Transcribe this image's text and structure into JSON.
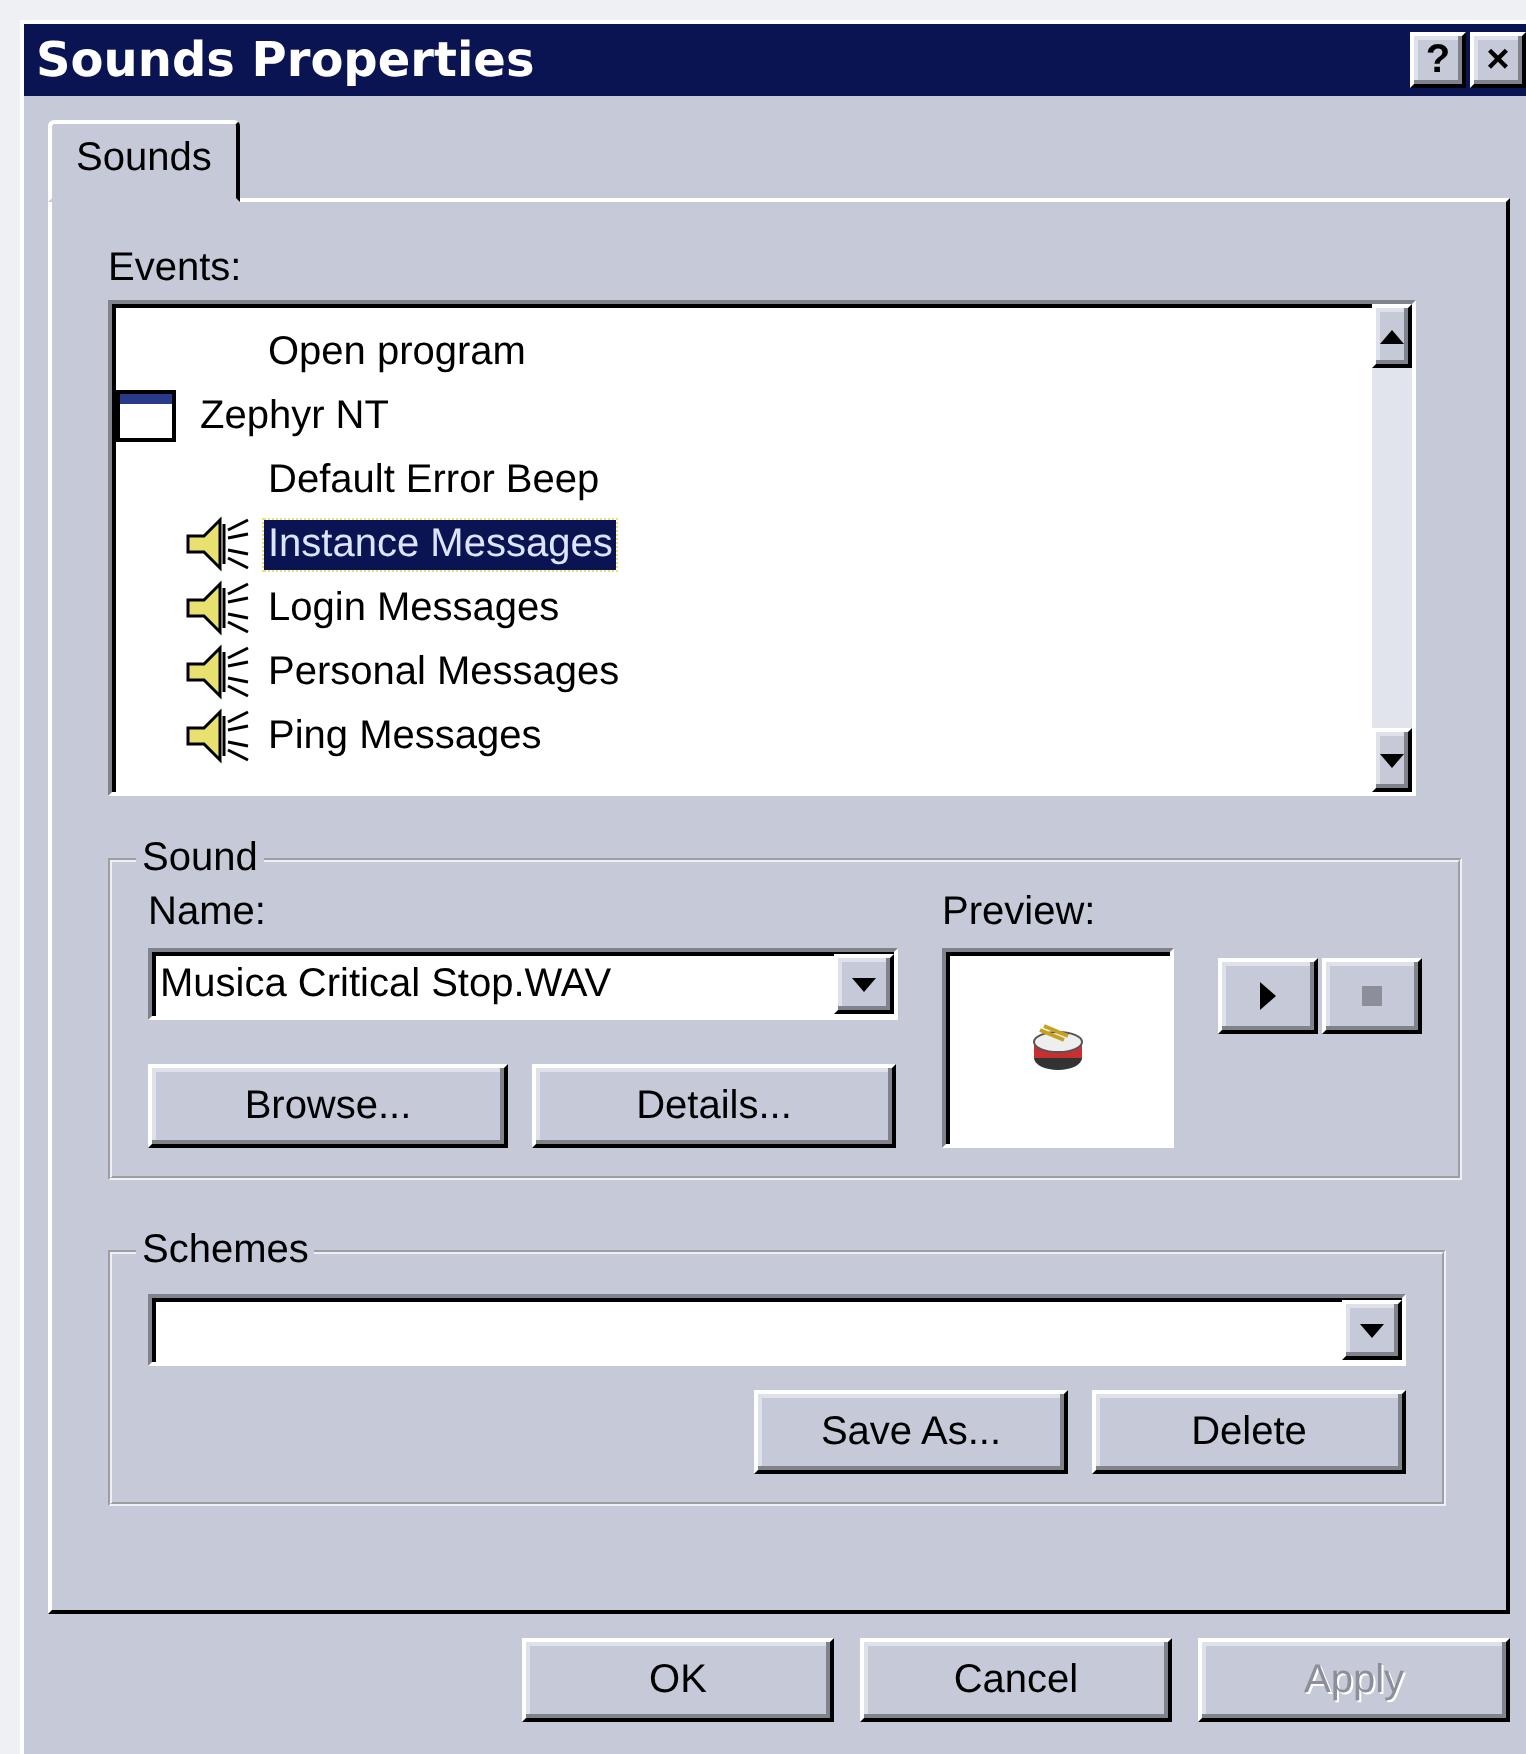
{
  "window": {
    "title": "Sounds Properties",
    "help_button": "?",
    "close_button": "×"
  },
  "tabs": [
    {
      "label": "Sounds",
      "selected": true
    }
  ],
  "events": {
    "label": "Events:",
    "items": [
      {
        "label": "Open program",
        "kind": "none",
        "selected": false
      },
      {
        "label": "Zephyr NT",
        "kind": "app",
        "selected": false,
        "children": [
          {
            "label": "Default Error Beep",
            "kind": "none",
            "selected": false
          },
          {
            "label": "Instance Messages",
            "kind": "sound",
            "selected": true
          },
          {
            "label": "Login Messages",
            "kind": "sound",
            "selected": false
          },
          {
            "label": "Personal Messages",
            "kind": "sound",
            "selected": false
          },
          {
            "label": "Ping Messages",
            "kind": "sound",
            "selected": false
          }
        ]
      }
    ]
  },
  "sound": {
    "title": "Sound",
    "name_label": "Name:",
    "name_value": "Musica Critical Stop.WAV",
    "preview_label": "Preview:",
    "buttons": [
      {
        "label": "Browse..."
      },
      {
        "label": "Details..."
      }
    ],
    "play": {
      "disabled": false
    },
    "stop": {
      "disabled": true
    }
  },
  "schemes": {
    "title": "Schemes",
    "buttons": [
      {
        "label": "Save As..."
      },
      {
        "label": "Delete"
      }
    ]
  },
  "buttons": [
    {
      "label": "OK",
      "disabled": false
    },
    {
      "label": "Cancel",
      "disabled": false
    },
    {
      "label": "Apply",
      "disabled": true
    }
  ]
}
